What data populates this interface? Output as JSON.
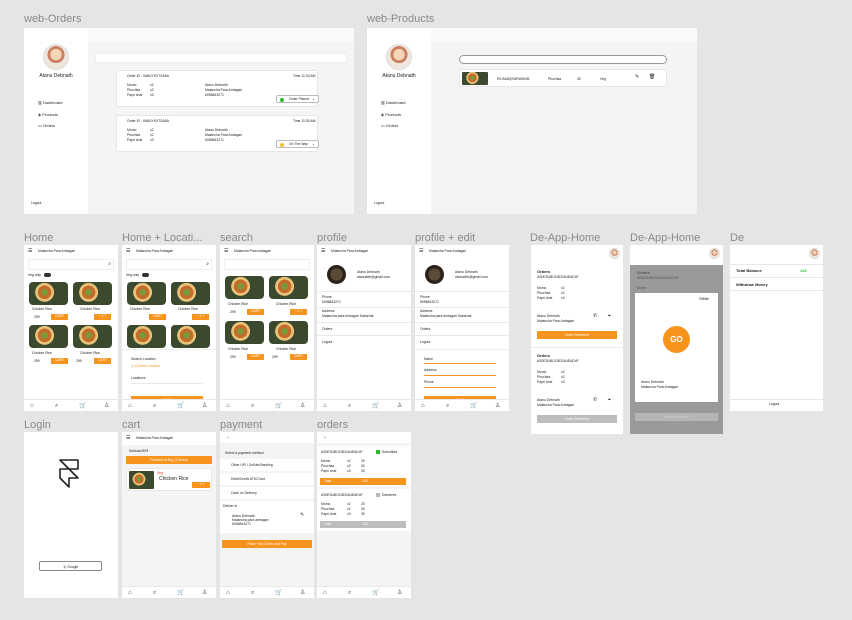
{
  "frames": {
    "web_orders": "web-Orders",
    "web_products": "web-Products",
    "home": "Home",
    "home_location": "Home + Locati...",
    "search": "search",
    "profile": "profile",
    "profile_edit": "profile + edit",
    "de_app_home_1": "De-App-Home",
    "de_app_home_2": "De-App-Home",
    "de": "De",
    "login": "Login",
    "cart": "cart",
    "payment": "payment",
    "orders": "orders"
  },
  "web": {
    "user_name": "Atanu Debnath",
    "sidebar": [
      {
        "label": "Dashboard",
        "icon": "bar-chart-icon"
      },
      {
        "label": "Products",
        "icon": "cube-icon"
      },
      {
        "label": "Orders",
        "icon": "clipboard-icon"
      }
    ],
    "logout": "Logout",
    "orders": [
      {
        "id": "Order ID : VA8UYKXTSA8A",
        "time": "Time 11:30 AM",
        "items": [
          [
            "Momo",
            "x2"
          ],
          [
            "Phuchka",
            "x2"
          ],
          [
            "Papri chat",
            "x3"
          ]
        ],
        "customer": "Atanu Debnath",
        "address": "Malancha Para Amtagari",
        "phone": "6096843271",
        "status": "Order Placed",
        "status_color": "#2eb82e"
      },
      {
        "id": "Order ID : VA8UYKXTSA8A",
        "time": "Time 11:30 AM",
        "items": [
          [
            "Momo",
            "x2"
          ],
          [
            "Phuchka",
            "x2"
          ],
          [
            "Papri chat",
            "x3"
          ]
        ],
        "customer": "Atanu Debnath",
        "address": "Malancha Para Amtagari",
        "phone": "6096843271",
        "status": "On The Way",
        "status_color": "#f2c12e"
      }
    ],
    "product": {
      "id": "E0-BA8Q0WRA9K0B",
      "name": "Phuchka",
      "price": "30",
      "type": "Veg"
    }
  },
  "app": {
    "header_location": "Malancha Para Amtagari",
    "veg_only": "Veg only",
    "foods": [
      {
        "name": "Chicken Rice",
        "price": "299"
      },
      {
        "name": "Chicken Rice",
        "price": "299"
      },
      {
        "name": "Chicken Rice",
        "price": "299"
      },
      {
        "name": "Chicken Rice",
        "price": "299"
      }
    ],
    "add_label": "CART",
    "search_location": "Search Location",
    "current_location": "Current Location",
    "locations": "Locations",
    "save": "SAVE",
    "profile_name": "Atanu Debnath",
    "profile_email": "atanudeb@gmail.com",
    "phone_label": "Phone",
    "phone": "6096843271",
    "address_label": "Address",
    "address": "Malancha para Amtagari Sabarhat",
    "orders_link": "Orders",
    "logout_link": "Logout",
    "edit_fields": [
      "Name",
      "Address",
      "Phone"
    ],
    "login_button": "Google",
    "cart_subtotal": "Subtotal 80₹",
    "cart_proceed": "Proceed to Buy (1 items)",
    "cart_item": "Chicken Rice",
    "cart_item_tag": "Veg",
    "payment_title": "Select a payment method",
    "payment_methods": [
      "Other UPI / Do/Net Banking",
      "Debit/Credit ATM Card",
      "Cash on Delivery"
    ],
    "deliver_to": "Deliver to",
    "deliver_name": "Atanu Debnath",
    "deliver_addr": "Malancha para amtagari",
    "deliver_phone": "6096843271",
    "place_order": "Place Your Order and Pay",
    "orders_list": [
      {
        "id": "AS0E3UBOC8D0A4EAD4F",
        "status": "Submitted",
        "status_color": "#2eb82e",
        "rows": [
          [
            "Momo",
            "x2",
            "20"
          ],
          [
            "Phuchka",
            "x2",
            "30"
          ],
          [
            "Papri chat",
            "x3",
            "30"
          ]
        ],
        "total_label": "Total",
        "total": "130",
        "total_bg": "#f7941d"
      },
      {
        "id": "AS0E3UBOC8D0A4EAD4F",
        "status": "Delivered",
        "status_color": "#bbbbbb",
        "rows": [
          [
            "Momo",
            "x2",
            "20"
          ],
          [
            "Phuchka",
            "x2",
            "30"
          ],
          [
            "Papri chat",
            "x3",
            "30"
          ]
        ],
        "total_label": "Total",
        "total": "130",
        "total_bg": "#bdbdbd"
      }
    ]
  },
  "de": {
    "orders_title": "Orders",
    "order_id": "AS0E3UBOC8D0A4EAD4F",
    "rows": [
      [
        "Momo",
        "x2"
      ],
      [
        "Phuchka",
        "x2"
      ],
      [
        "Papri chat",
        "x3"
      ]
    ],
    "customer": "Atanu Debnath",
    "address": "Malancha Para Amtagari",
    "order_delivered": "Order Delivered",
    "go": "GO",
    "distance": "29Mile",
    "total_balance_label": "Total Balance",
    "total_balance": "120",
    "withdraw": "Withdraw Money",
    "logout": "Logout"
  }
}
